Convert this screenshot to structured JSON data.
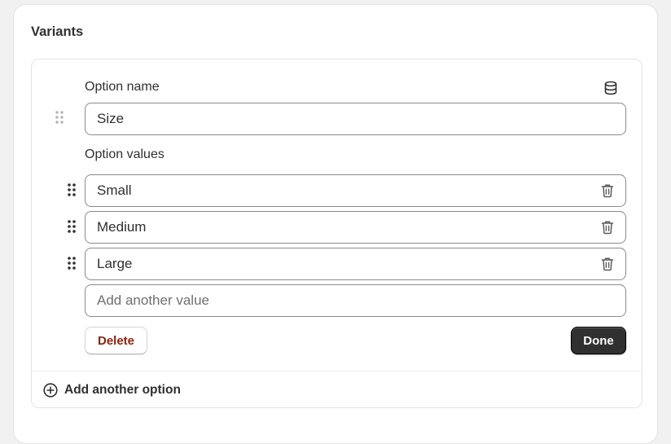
{
  "card": {
    "title": "Variants"
  },
  "option": {
    "name_label": "Option name",
    "name_value": "Size",
    "values_label": "Option values",
    "values": [
      {
        "value": "Small"
      },
      {
        "value": "Medium"
      },
      {
        "value": "Large"
      }
    ],
    "new_value_placeholder": "Add another value",
    "delete_label": "Delete",
    "done_label": "Done"
  },
  "footer": {
    "add_option_label": "Add another option"
  },
  "icons": {
    "metafield": "database-icon",
    "drag": "drag-handle-icon",
    "remove": "trash-icon",
    "add": "plus-circle-icon"
  },
  "colors": {
    "delete_text": "#8e1f0b",
    "primary_button": "#303030"
  }
}
